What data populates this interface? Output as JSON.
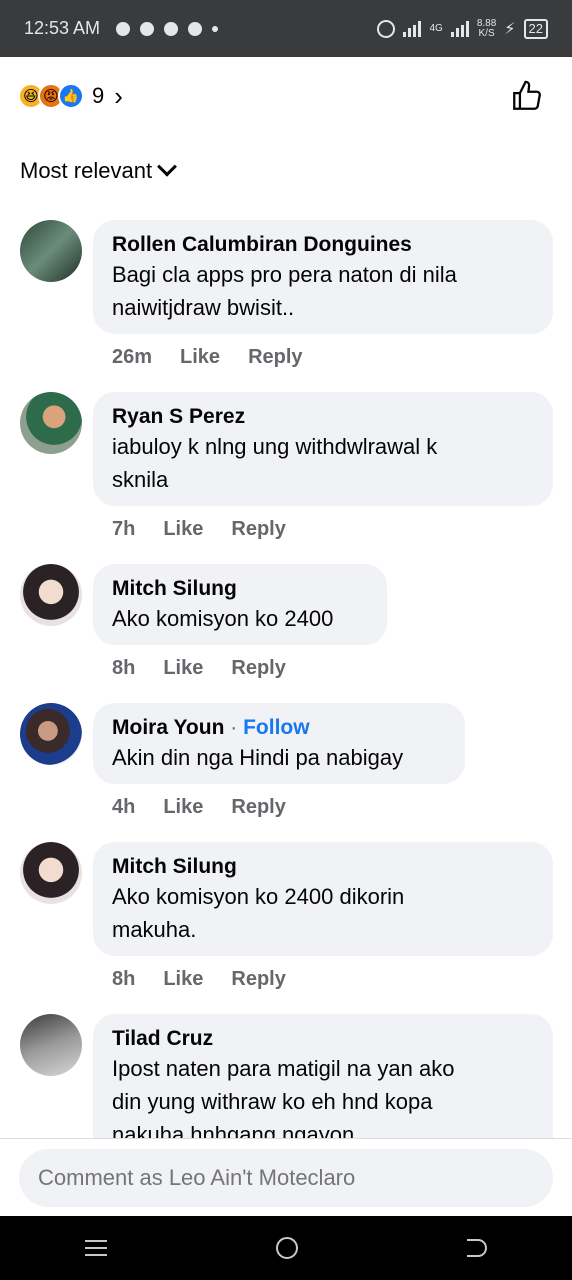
{
  "status_bar": {
    "time": "12:53 AM",
    "net_type": "4G",
    "speed": "8.88",
    "speed_unit": "K/S",
    "battery": "22"
  },
  "reactions": {
    "icons": [
      "haha-icon",
      "angry-icon",
      "like-icon"
    ],
    "count": "9"
  },
  "sort": {
    "label": "Most relevant"
  },
  "comments": [
    {
      "author": "Rollen Calumbiran Donguines",
      "follow": "",
      "text": [
        "Bagi cla apps pro pera naton di nila",
        "naiwitjdraw bwisit.."
      ],
      "time": "26m",
      "like": "Like",
      "reply": "Reply"
    },
    {
      "author": "Ryan S Perez",
      "follow": "",
      "text": [
        "iabuloy k nlng ung withdwlrawal k",
        "sknila"
      ],
      "time": "7h",
      "like": "Like",
      "reply": "Reply"
    },
    {
      "author": "Mitch Silung",
      "follow": "",
      "text": [
        "Ako komisyon ko 2400"
      ],
      "time": "8h",
      "like": "Like",
      "reply": "Reply"
    },
    {
      "author": "Moira Youn",
      "follow": "Follow",
      "text": [
        "Akin din nga Hindi pa nabigay"
      ],
      "time": "4h",
      "like": "Like",
      "reply": "Reply"
    },
    {
      "author": "Mitch Silung",
      "follow": "",
      "text": [
        "Ako komisyon ko 2400 dikorin",
        "makuha."
      ],
      "time": "8h",
      "like": "Like",
      "reply": "Reply"
    },
    {
      "author": "Tilad Cruz",
      "follow": "",
      "text": [
        "Ipost naten para matigil na yan ako",
        "din yung withraw ko eh hnd kopa",
        "nakuha hnhgang ngayon"
      ],
      "time": "",
      "like": "",
      "reply": ""
    }
  ],
  "composer": {
    "placeholder": "Comment as Leo Ain't Moteclaro"
  },
  "colors": {
    "accent": "#1877f2",
    "bubble": "#f0f2f5",
    "meta": "#65676b"
  }
}
